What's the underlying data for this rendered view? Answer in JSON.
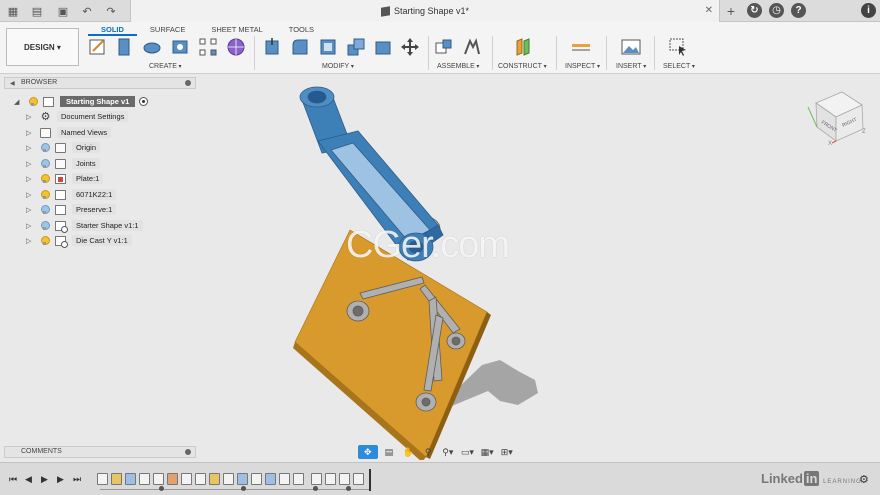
{
  "window": {
    "doc_title": "Starting Shape v1*"
  },
  "toolbar": {
    "workspace_label": "DESIGN ▾",
    "tabs": [
      {
        "label": "SOLID",
        "active": true
      },
      {
        "label": "SURFACE",
        "active": false
      },
      {
        "label": "SHEET METAL",
        "active": false
      },
      {
        "label": "TOOLS",
        "active": false
      }
    ],
    "groups": [
      "CREATE",
      "MODIFY",
      "ASSEMBLE",
      "CONSTRUCT",
      "INSPECT",
      "INSERT",
      "SELECT"
    ]
  },
  "browser": {
    "title": "BROWSER",
    "root": "Starting Shape v1",
    "items": [
      {
        "label": "Document Settings"
      },
      {
        "label": "Named Views"
      },
      {
        "label": "Origin"
      },
      {
        "label": "Joints"
      },
      {
        "label": "Plate:1"
      },
      {
        "label": "6071K22:1"
      },
      {
        "label": "Preserve:1"
      },
      {
        "label": "Starter Shape v1:1"
      },
      {
        "label": "Die Cast Y v1:1"
      }
    ]
  },
  "comments": {
    "title": "COMMENTS"
  },
  "watermark": {
    "text": "CGer.com"
  },
  "viewcube": {
    "front": "FRONT",
    "right": "RIGHT",
    "axis_x": "X",
    "axis_z": "Z"
  },
  "branding": {
    "linkedin": "Linked",
    "in": "in",
    "learning": "LEARNING"
  },
  "colors": {
    "accent": "#0a6fc2",
    "model_blue": "#3d7fb7",
    "plate_orange": "#d89a2c",
    "part_gray": "#a9a9a9"
  }
}
